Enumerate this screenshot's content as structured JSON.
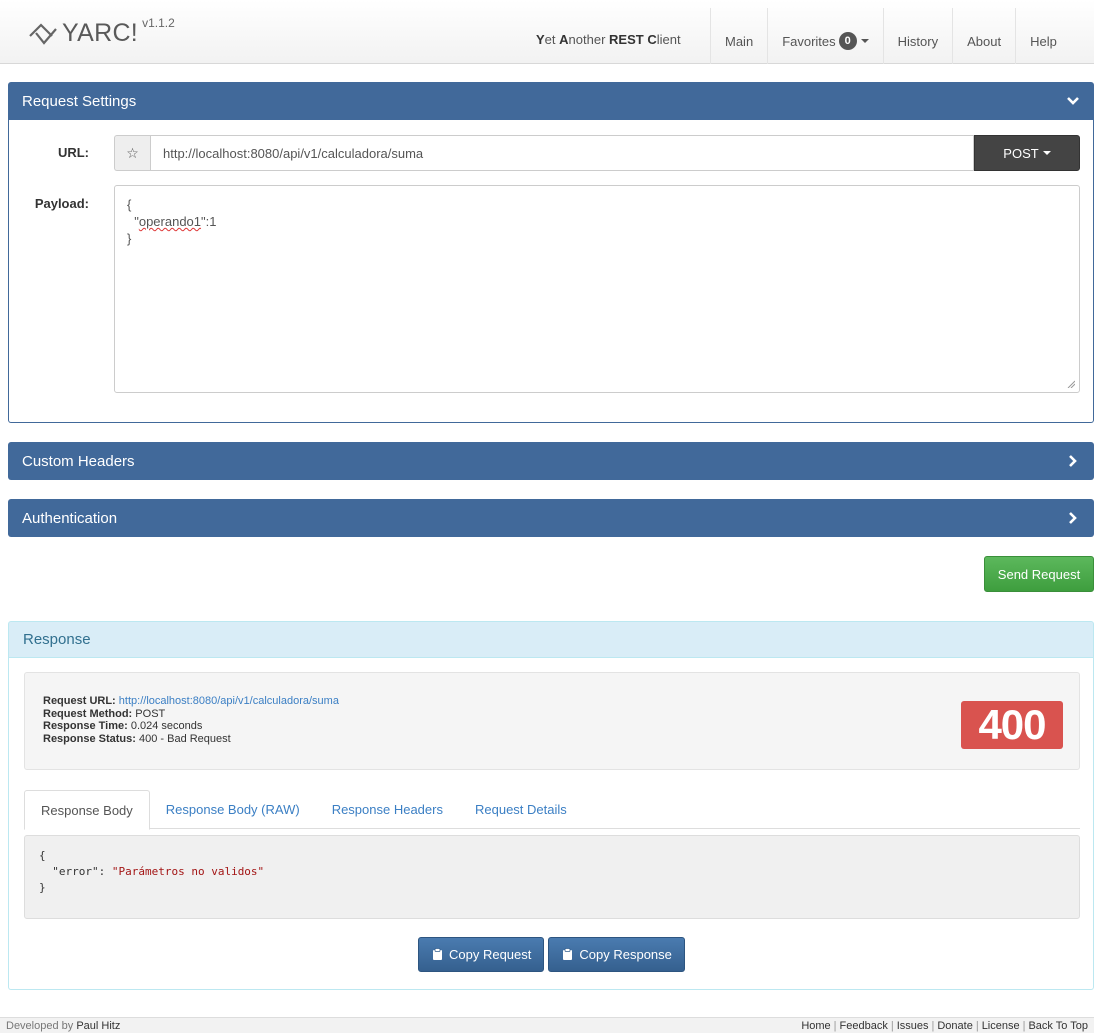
{
  "header": {
    "brand": "YARC!",
    "version": "v1.1.2",
    "tagline_parts": [
      {
        "bold": "Y",
        "rest": "et "
      },
      {
        "bold": "A",
        "rest": "nother "
      },
      {
        "bold": "REST",
        "rest": " "
      },
      {
        "bold": "C",
        "rest": "lient"
      }
    ],
    "nav": {
      "main": "Main",
      "favorites": "Favorites",
      "favorites_count": "0",
      "history": "History",
      "about": "About",
      "help": "Help"
    }
  },
  "request_settings": {
    "title": "Request Settings",
    "url_label": "URL:",
    "url_value": "http://localhost:8080/api/v1/calculadora/suma",
    "method": "POST",
    "payload_label": "Payload:",
    "payload_lines": [
      "{",
      "  \"",
      "operando1",
      "\":1",
      "}"
    ]
  },
  "custom_headers": {
    "title": "Custom Headers"
  },
  "authentication": {
    "title": "Authentication"
  },
  "send_button": "Send Request",
  "response": {
    "title": "Response",
    "request_url_label": "Request URL:",
    "request_url": "http://localhost:8080/api/v1/calculadora/suma",
    "request_method_label": "Request Method:",
    "request_method": "POST",
    "response_time_label": "Response Time:",
    "response_time": "0.024 seconds",
    "response_status_label": "Response Status:",
    "response_status": "400 - Bad Request",
    "status_code": "400",
    "tabs": [
      "Response Body",
      "Response Body (RAW)",
      "Response Headers",
      "Request Details"
    ],
    "body": {
      "open": "{",
      "key": "  \"error\": ",
      "value": "\"Parámetros no validos\"",
      "close": "}"
    },
    "copy_request": "Copy Request",
    "copy_response": "Copy Response"
  },
  "footer": {
    "developed_by": "Developed by",
    "developer": "Paul Hitz",
    "links": [
      "Home",
      "Feedback",
      "Issues",
      "Donate",
      "License",
      "Back To Top"
    ]
  },
  "colors": {
    "panel_blue": "#41699a",
    "response_header_bg": "#d9edf7",
    "send_green": "#5cb85c",
    "status_red": "#d9534f"
  }
}
